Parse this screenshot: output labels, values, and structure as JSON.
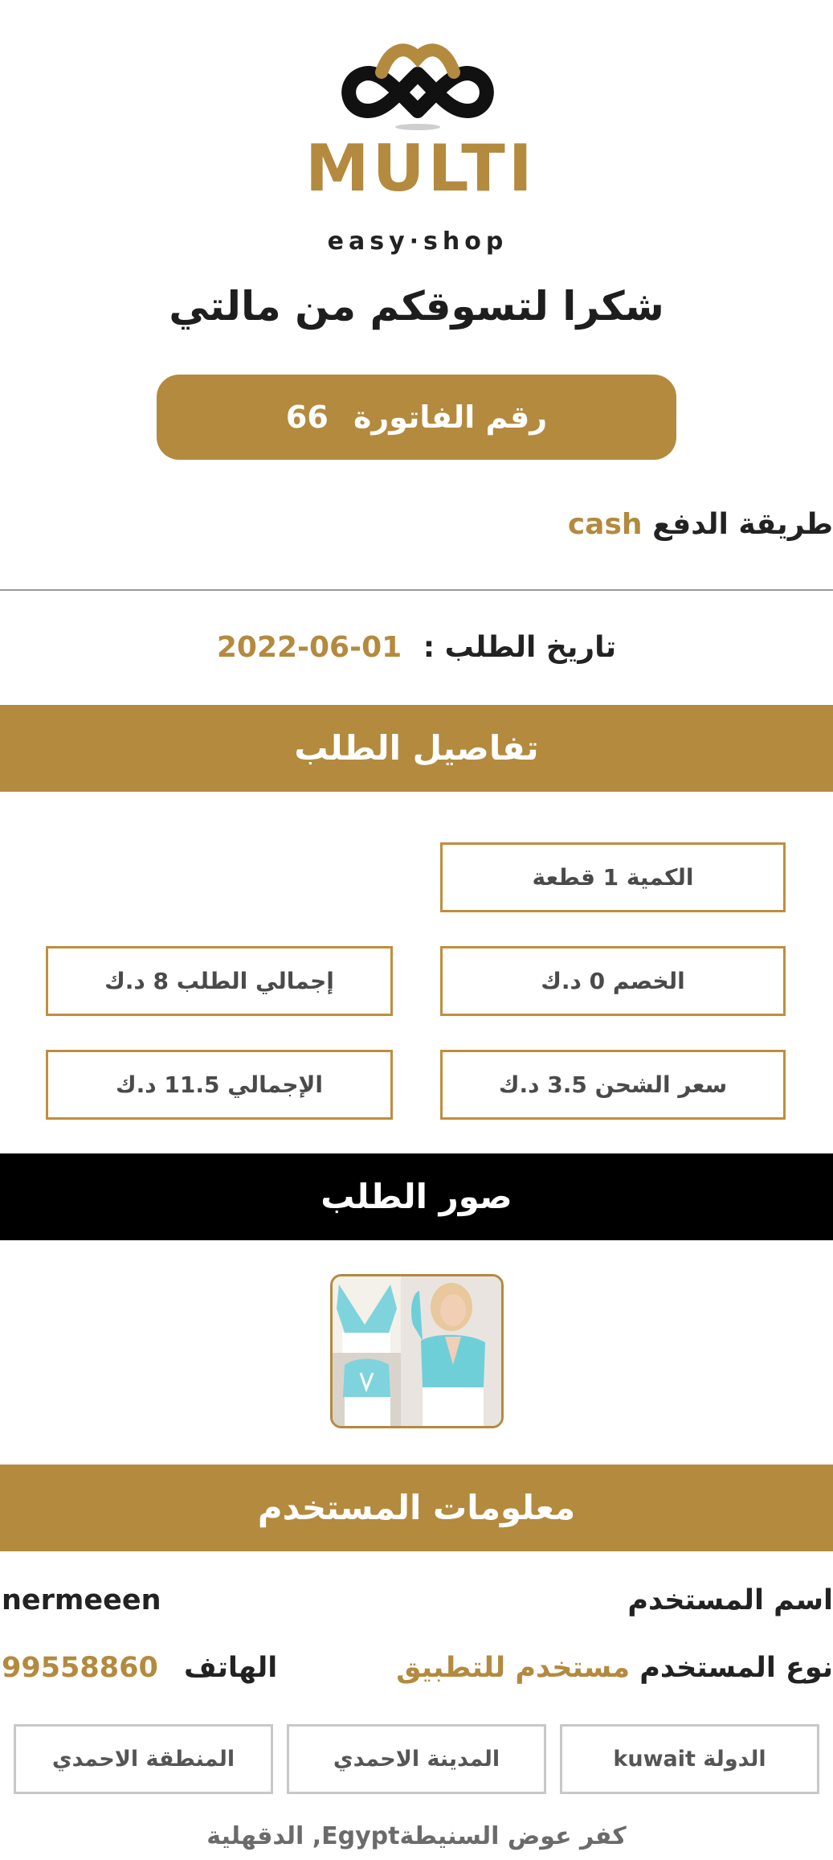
{
  "brand": {
    "name": "MULTI",
    "tagline": "easy·shop",
    "color": "#B38A3E"
  },
  "thanks_title": "شكرا لتسوقكم من مالتي",
  "invoice": {
    "label": "رقم الفاتورة",
    "number": "66"
  },
  "payment": {
    "label": "طريقة الدفع",
    "value": "cash"
  },
  "order_date": {
    "label": "تاريخ الطلب :",
    "value": "01-06-2022"
  },
  "order_details": {
    "title": "تفاصيل الطلب",
    "quantity": "الكمية 1 قطعة",
    "discount": "الخصم  0  د.ك",
    "subtotal": "إجمالي الطلب  8 د.ك",
    "shipping": "سعر الشحن   3.5 د.ك",
    "total": "الإجمالي  11.5 د.ك"
  },
  "order_images": {
    "title": "صور الطلب",
    "thumbnail_icon": "product-photo-icon"
  },
  "user_info": {
    "title": "معلومات  المستخدم",
    "username_label": "اسم المستخدم",
    "username": "nermeeen",
    "type_label": "نوع المستخدم",
    "type_value": "مستخدم للتطبيق",
    "phone_label": "الهاتف",
    "phone": "99558860",
    "country": "الدولة   kuwait",
    "city": "المدينة  الاحمدي",
    "area": "المنطقة  الاحمدي",
    "address": "كفر عوض السنيطةEgypt, الدقهلية"
  },
  "colors": {
    "accent": "#B38A3E",
    "dark_band": "#000000",
    "divider": "#999999"
  }
}
